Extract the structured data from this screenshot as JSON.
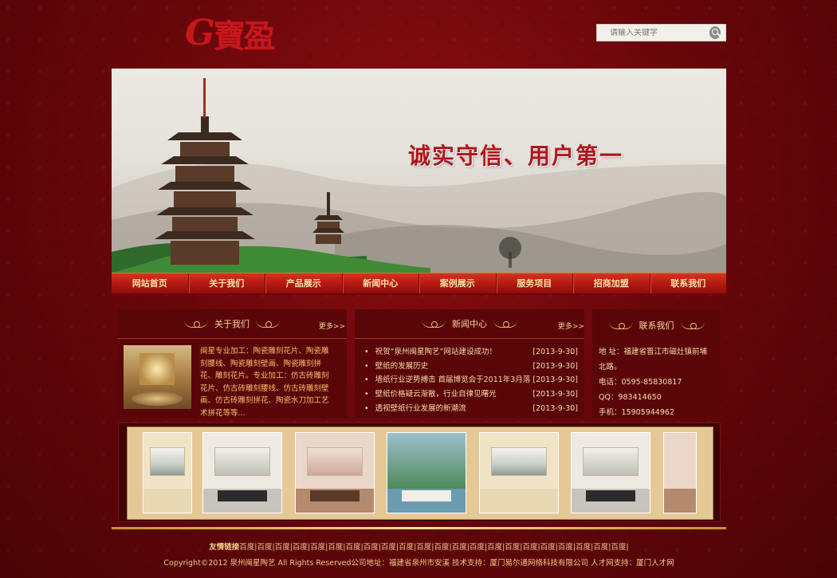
{
  "logo": {
    "letter": "G",
    "chinese": "寶盈"
  },
  "search": {
    "placeholder": "请输入关键字"
  },
  "banner": {
    "slogan": "诚实守信、用户第一"
  },
  "nav": [
    "网站首页",
    "关于我们",
    "产品展示",
    "新闻中心",
    "案例展示",
    "服务项目",
    "招商加盟",
    "联系我们"
  ],
  "about": {
    "title": "关于我们",
    "more": "更多>>",
    "text": "闽星专业加工：陶瓷雕刻花片、陶瓷雕刻腰线、陶瓷雕刻壁画、陶瓷雕刻拼花、雕刻花片。专业加工：仿古砖雕刻花片、仿古砖雕刻腰线、仿古砖雕刻壁画、仿古砖雕刻拼花、陶瓷水刀加工艺术拼花等等..."
  },
  "news": {
    "title": "新闻中心",
    "more": "更多>>",
    "items": [
      {
        "title": "祝贺“泉州闽星陶艺”网站建设成功！",
        "date": "[2013-9-30]"
      },
      {
        "title": "壁纸的发展历史",
        "date": "[2013-9-30]"
      },
      {
        "title": "墙纸行业逆势搏击 首届博览会于2011年3月落",
        "date": "[2013-9-30]"
      },
      {
        "title": "壁纸价格疑云渐散，行业自律见曙光",
        "date": "[2013-9-30]"
      },
      {
        "title": "透视壁纸行业发展的新潮流",
        "date": "[2013-9-30]"
      }
    ]
  },
  "contact": {
    "title": "联系我们",
    "address": "地 址：福建省晋江市磁灶镇前埔北路。",
    "phone": "电话：0595-85830817",
    "qq": "QQ：983414650",
    "mobile": "手机：15905944962"
  },
  "footer": {
    "links_label": "友情链接",
    "links": "百度|百度|百度|百度|百度|百度|百度|百度|百度|百度|百度|百度|百度|百度|百度|百度|百度|百度|百度|百度|百度|百度|",
    "copyright": "Copyright©2012 泉州闽星陶艺 All Rights Reserved公司地址：福建省泉州市安溪 技术支持：厦门易尔通网络科技有限公司 人才网支持：厦门人才网"
  },
  "colors": {
    "primary": "#8e0e12",
    "accent": "#c8161d",
    "gold": "#f1c98a"
  }
}
